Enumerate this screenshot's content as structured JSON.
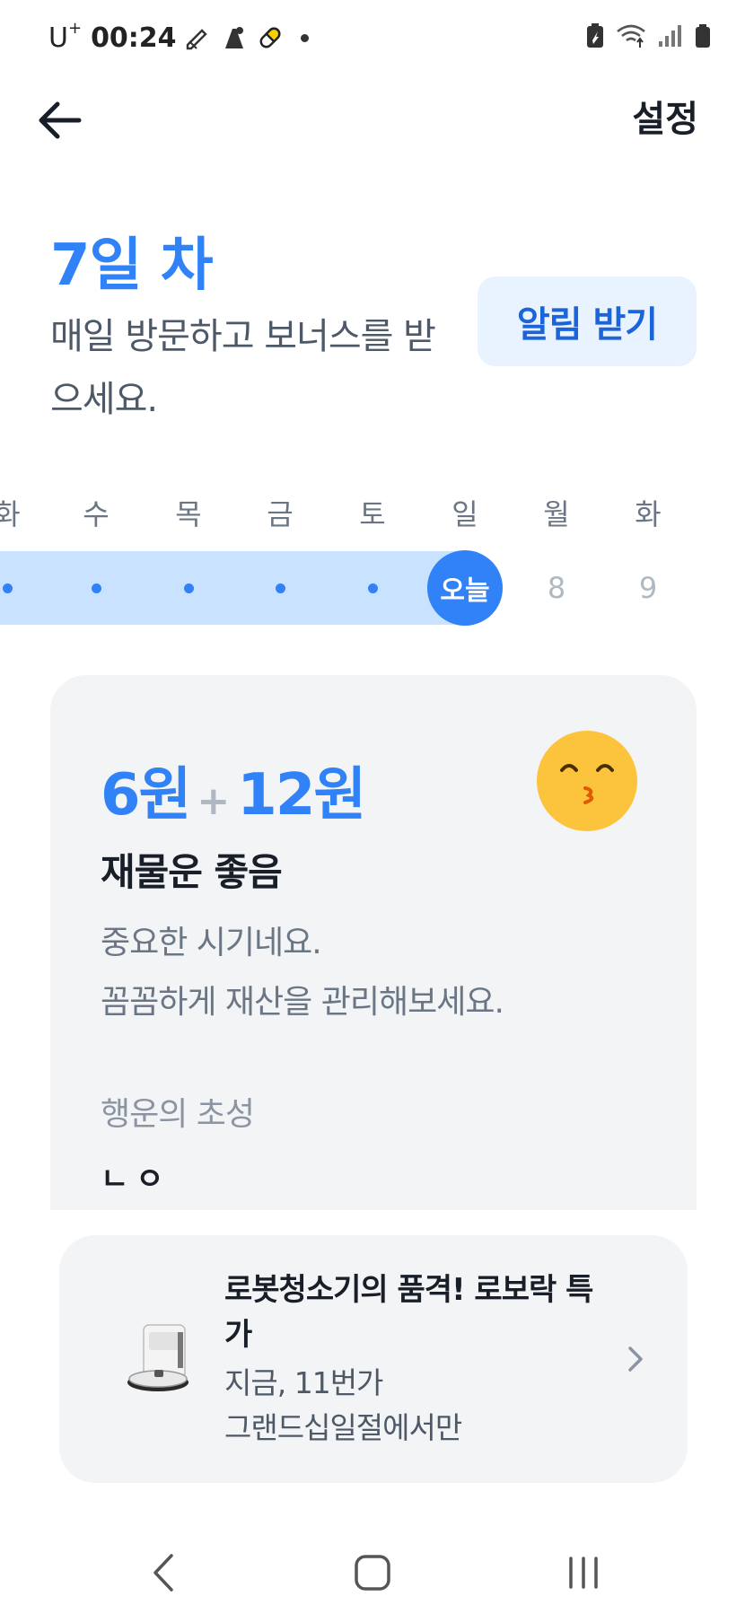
{
  "status_bar": {
    "carrier": "U",
    "carrier_sup": "+",
    "time": "00:24",
    "icons": [
      "edit-note-icon",
      "app-icon",
      "pill-icon",
      "notification-dot-icon",
      "battery-saver-icon",
      "wifi-icon",
      "signal-icon",
      "battery-icon"
    ]
  },
  "header": {
    "back_icon": "arrow-left-icon",
    "settings_label": "설정"
  },
  "intro": {
    "day_title": "7일 차",
    "subtitle": "매일 방문하고 보너스를 받으세요.",
    "notify_button": "알림 받기"
  },
  "week": {
    "days": [
      {
        "label": "화",
        "mark": "",
        "state": "visited"
      },
      {
        "label": "수",
        "mark": "",
        "state": "visited"
      },
      {
        "label": "목",
        "mark": "",
        "state": "visited"
      },
      {
        "label": "금",
        "mark": "",
        "state": "visited"
      },
      {
        "label": "토",
        "mark": "",
        "state": "visited"
      },
      {
        "label": "일",
        "mark": "오늘",
        "state": "today"
      },
      {
        "label": "월",
        "mark": "8",
        "state": "future"
      },
      {
        "label": "화",
        "mark": "9",
        "state": "future"
      }
    ]
  },
  "fortune": {
    "amount_base": "6원",
    "plus": "+",
    "amount_bonus": "12원",
    "emoji": "kissing-face-emoji",
    "title": "재물운 좋음",
    "desc_line1": "중요한 시기네요.",
    "desc_line2": "꼼꼼하게 재산을 관리해보세요.",
    "luck_label": "행운의 초성",
    "luck_initials": "ㄴㅇ"
  },
  "ad": {
    "image": "robot-vacuum-image",
    "title": "로봇청소기의 품격! 로보락 특가",
    "sub_line1": "지금, 11번가",
    "sub_line2": "그랜드십일절에서만",
    "chevron": "chevron-right-icon"
  },
  "nav": {
    "back": "nav-back-icon",
    "home": "nav-home-icon",
    "recents": "nav-recents-icon"
  },
  "colors": {
    "accent": "#3182f6",
    "accent_light": "#c9e2ff",
    "button_bg": "#e8f3ff",
    "card_bg": "#f2f4f6",
    "emoji_yellow": "#fcc43d"
  }
}
